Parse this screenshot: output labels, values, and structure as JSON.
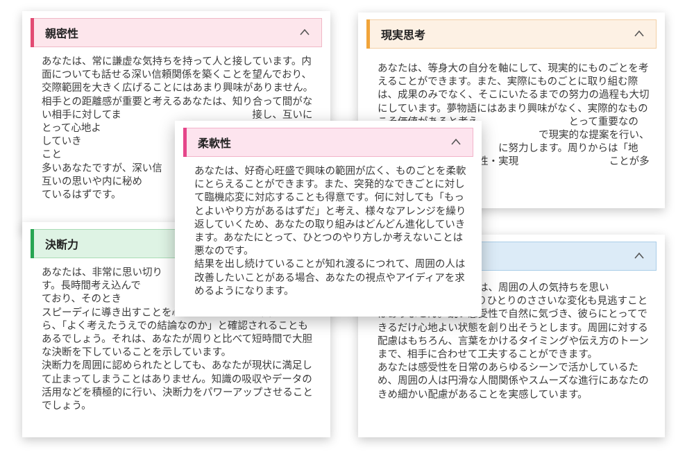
{
  "cards": {
    "intimacy": {
      "title": "親密性",
      "body": [
        "あなたは、常に謙虚な気持ちを持って人と接しています。内面についても話せる深い信頼関係を築くことを望んでおり、交際範囲を大きく広げることにはあまり興味がありません。",
        "相手との距離感が重要と考えるあなたは、知り合って間がない相手に対してま　　　　　　　　　　　　　接し、互いにとって心地よ　　　　　　　　　　　　　に信頼関係を構築していき　　　　　　　　　　　　　い」など、評価されること　　　　　　　　　　　　　多くの人が集まる場ではお　　　　　　　　　　　　　多いあなたですが、深い信　　　　　　　　　　　　　とは互いの思いや内に秘め　　　　　　　　　　　　　解しあえているはずです。"
      ]
    },
    "realism": {
      "title": "現実思考",
      "body": [
        "あなたは、等身大の自分を軸にして、現実的にものごとを考えることができます。また、実際にものごとに取り組む際は、成果のみでなく、そこにいたるまでの努力の過程も大切にしています。夢物語にはあまり興味がなく、実際的なものこそ価値があると考え　　　　　　　　　とって重要なのは、「今この時」　　　　　　　　　で現実的な提案を行い、実現可　　　　　　　　　に努力します。周りからは「地　　　　　　　　　に表現され、その堅実性・実現　　　　　　　　　ことが多いでしょう。"
      ]
    },
    "decisiveness": {
      "title": "決断力",
      "body": [
        "あなたは、非常に思い切り　　　　　　　　　　　　　きます。長時間考え込んで　　　　　　　　　　　　　いと考えており、そのとき　　　　　　　　　　　　　明確な結論をスピーディに導き出すことを心がけています。周囲の人から、「よく考えたうえでの結論なのか」と確認されることもあるでしょう。それは、あなたが周りと比べて短時間で大胆な決断を下していることを示しています。",
        "決断力を周囲に認められたとしても、あなたが現状に満足して止まってしまうことはありません。知識の吸収やデータの活用などを積極的に行い、決断力をパワーアップさせることでしょう。"
      ]
    },
    "sensitivity": {
      "title": "",
      "body": [
        "　　　　　　　　　　は、周囲の人の気持ちを思い　　　　　　　　　　ことができます。ひとりひとりのささいな変化も見逃すことはありません。鋭い感受性で自然に気づき、彼らにとってできるだけ心地よい状態を創り出そうとします。周囲に対する配慮はもちろん、言葉をかけるタイミングや伝え方のトーンまで、相手に合わせて工夫することができます。",
        "あなたは感受性を日常のあらゆるシーンで活かしているため、周囲の人は円滑な人間関係やスムーズな進行にあなたのきめ細かい配慮があることを実感しています。"
      ]
    },
    "flexibility": {
      "title": "柔軟性",
      "body": [
        "あなたは、好奇心旺盛で興味の範囲が広く、ものごとを柔軟にとらえることができます。また、突発的なできごとに対して臨機応変に対応することも得意です。何に対しても「もっとよいやり方があるはずだ」と考え、様々なアレンジを繰り返していくため、あなたの取り組みはどんどん進化していきます。あなたにとって、ひとつのやり方しか考えないことは悪なのです。",
        "結果を出し続けていることが知れ渡るにつれて、周囲の人は改善したいことがある場合、あなたの視点やアイディアを求めるようになります。"
      ]
    }
  },
  "icons": {
    "collapse": "chevron-up-icon"
  },
  "colors": {
    "intimacy_accent": "#e24b73",
    "realism_accent": "#f1a43a",
    "decisiveness_accent": "#27a552",
    "sensitivity_accent": "#4a90c9",
    "flexibility_accent": "#e5468a"
  }
}
